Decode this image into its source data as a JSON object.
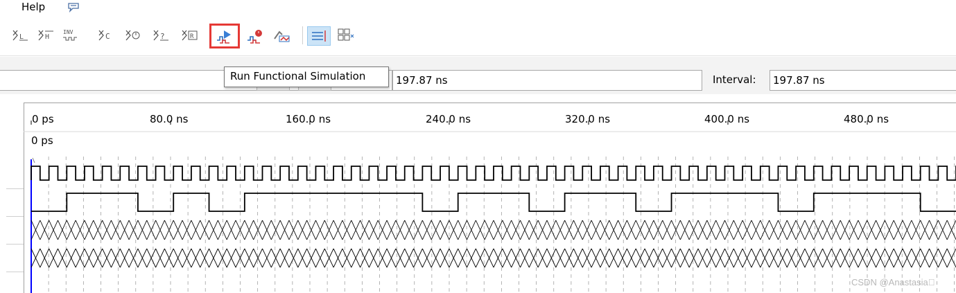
{
  "menu": {
    "help_label": "Help"
  },
  "toolbar": {
    "tools": [
      "Xl",
      "XH",
      "INV",
      "XC",
      "X0",
      "X?",
      "XR",
      "run-functional-simulation",
      "run-timing-simulation",
      "generate-netlist",
      "snap",
      "grid"
    ],
    "tooltip": "Run Functional Simulation"
  },
  "timebar": {
    "master_time": "197.87 ns",
    "interval_label": "Interval:",
    "interval_value": "197.87 ns"
  },
  "ruler": {
    "ticks": [
      "0 ps",
      "80.0 ns",
      "160.0 ns",
      "240.0 ns",
      "320.0 ns",
      "400.0 ns",
      "480.0 ns"
    ],
    "cursor_label": "0 ps"
  },
  "waveforms": {
    "clock_periods_visible": 52,
    "signal2_levels": [
      0,
      1,
      1,
      0,
      1,
      0,
      1,
      1,
      1,
      1,
      1,
      0,
      1,
      1,
      0,
      1,
      1,
      0,
      1,
      1,
      1,
      0,
      1,
      1,
      1,
      0
    ],
    "bus_signals": 2
  },
  "colors": {
    "highlight": "#e53935",
    "cursor": "#0000ff",
    "wave": "#000000",
    "grid": "#a0a0a0"
  },
  "watermark": "CSDN @Anastasia\u0000"
}
